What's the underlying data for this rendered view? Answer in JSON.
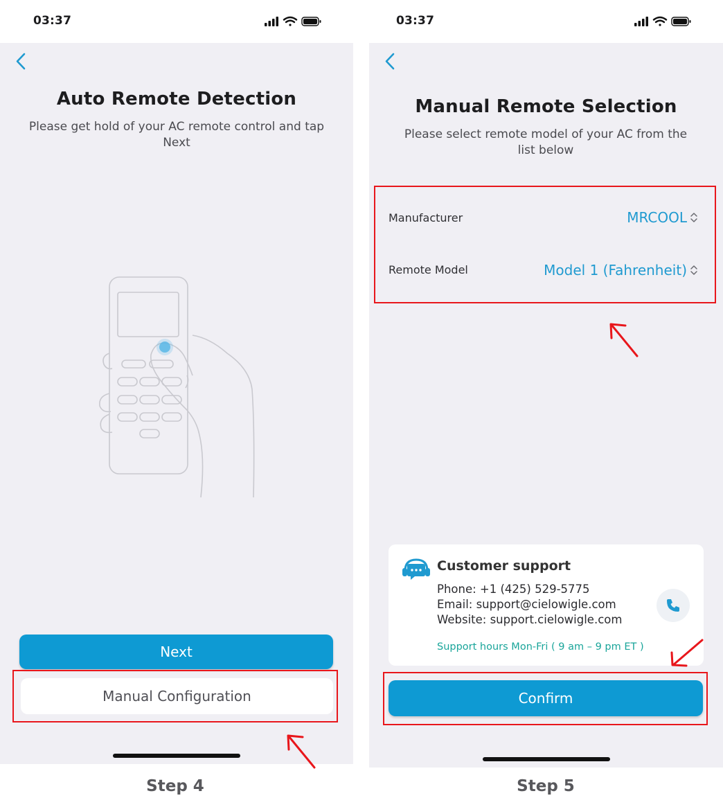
{
  "left_screen": {
    "time": "03:37",
    "title": "Auto Remote Detection",
    "subtitle": "Please get hold of your AC remote control and tap Next",
    "next_label": "Next",
    "manual_label": "Manual Configuration",
    "step": "Step 4"
  },
  "right_screen": {
    "time": "03:37",
    "title": "Manual Remote Selection",
    "subtitle": "Please select remote model of your AC from the list below",
    "manufacturer_label": "Manufacturer",
    "manufacturer_value": "MRCOOL",
    "model_label": "Remote Model",
    "model_value": "Model 1 (Fahrenheit)",
    "support": {
      "title": "Customer support",
      "phone": "Phone: +1 (425) 529-5775",
      "email": "Email: support@cielowigle.com",
      "website": "Website: support.cielowigle.com",
      "hours": "Support hours Mon-Fri ( 9 am – 9 pm ET )"
    },
    "confirm_label": "Confirm",
    "step": "Step 5"
  },
  "colors": {
    "accent": "#0e9ad3",
    "link_blue": "#1f9ad0",
    "support_green": "#1aa59a",
    "highlight_red": "#e8161b",
    "screen_bg": "#f0eff4"
  },
  "icons": [
    "cellular-signal-icon",
    "wifi-icon",
    "battery-icon",
    "chevron-left-icon",
    "chevron-updown-icon",
    "support-headset-icon",
    "phone-icon",
    "red-arrow-icon"
  ]
}
